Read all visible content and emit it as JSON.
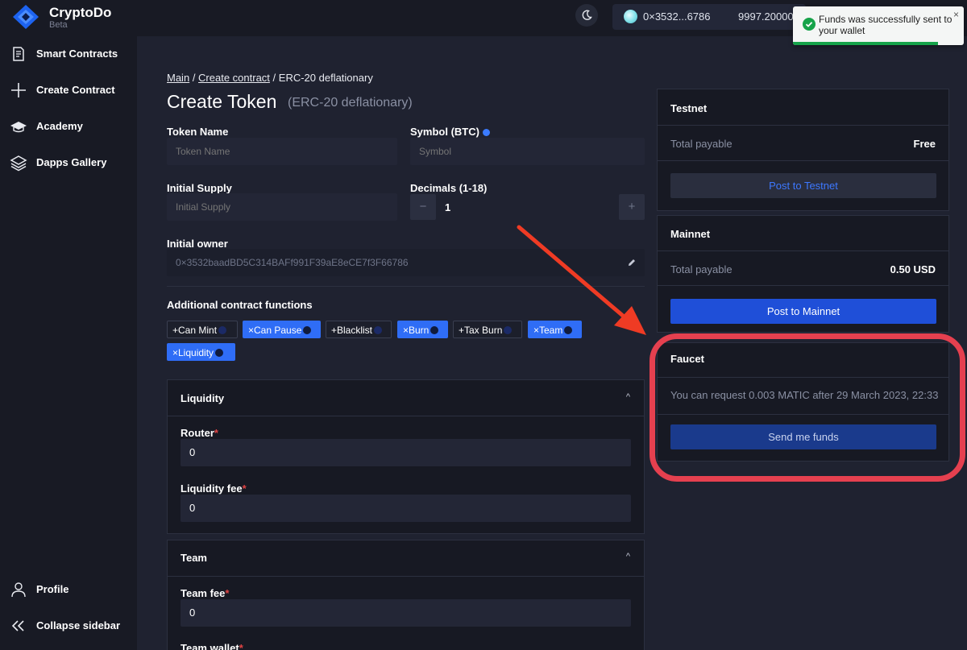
{
  "app": {
    "name": "CryptoDo",
    "subtitle": "Beta"
  },
  "header": {
    "wallet_address": "0×3532...6786",
    "wallet_balance": "9997.20000"
  },
  "toast": {
    "message": "Funds was successfully sent to your wallet",
    "close": "×",
    "progress": 0.85
  },
  "sidebar": {
    "items": [
      {
        "label": "Smart Contracts",
        "icon": "document-icon"
      },
      {
        "label": "Create Contract",
        "icon": "plus-icon"
      },
      {
        "label": "Academy",
        "icon": "graduation-cap-icon"
      },
      {
        "label": "Dapps Gallery",
        "icon": "layers-icon"
      }
    ],
    "bottom": [
      {
        "label": "Profile",
        "icon": "user-icon"
      },
      {
        "label": "Collapse sidebar",
        "icon": "double-chevron-left-icon"
      }
    ]
  },
  "breadcrumb": {
    "main": "Main",
    "create": "Create contract",
    "current": "/ ERC-20 deflationary"
  },
  "page": {
    "title": "Create Token",
    "subtitle": "(ERC-20 deflationary)"
  },
  "form": {
    "token_name": {
      "label": "Token Name",
      "placeholder": "Token Name"
    },
    "symbol": {
      "label": "Symbol (BTC)",
      "placeholder": "Symbol"
    },
    "initial_supply": {
      "label": "Initial Supply",
      "placeholder": "Initial Supply"
    },
    "decimals": {
      "label": "Decimals (1-18)",
      "value": "1",
      "minus": "−",
      "plus": "+"
    },
    "initial_owner": {
      "label": "Initial owner",
      "value": "0×3532baadBD5C314BAFf991F39aE8eCE7f3F66786"
    }
  },
  "functions": {
    "label": "Additional contract functions",
    "tags": [
      {
        "label": "+Can Mint",
        "active": false
      },
      {
        "label": "×Can Pause",
        "active": true
      },
      {
        "label": "+Blacklist",
        "active": false
      },
      {
        "label": "×Burn",
        "active": true
      },
      {
        "label": "+Tax Burn",
        "active": false
      },
      {
        "label": "×Team",
        "active": true
      },
      {
        "label": "×Liquidity",
        "active": true
      }
    ]
  },
  "liquidity": {
    "title": "Liquidity",
    "router_label": "Router",
    "router_value": "0",
    "fee_label": "Liquidity fee",
    "fee_value": "0"
  },
  "team": {
    "title": "Team",
    "fee_label": "Team fee",
    "fee_value": "0",
    "wallet_label": "Team wallet"
  },
  "testnet": {
    "title": "Testnet",
    "payable_label": "Total payable",
    "payable_value": "Free",
    "button": "Post to Testnet"
  },
  "mainnet": {
    "title": "Mainnet",
    "payable_label": "Total payable",
    "payable_value": "0.50 USD",
    "button": "Post to Mainnet"
  },
  "faucet": {
    "title": "Faucet",
    "info": "You can request 0.003 MATIC after 29 March 2023, 22:33",
    "button": "Send me funds"
  },
  "colors": {
    "accent": "#2f6df6",
    "primary_button": "#1f4fd8",
    "faucet_button": "#1a3a8c",
    "highlight": "#e5404f",
    "arrow": "#ef3b24",
    "success": "#16a34a"
  }
}
